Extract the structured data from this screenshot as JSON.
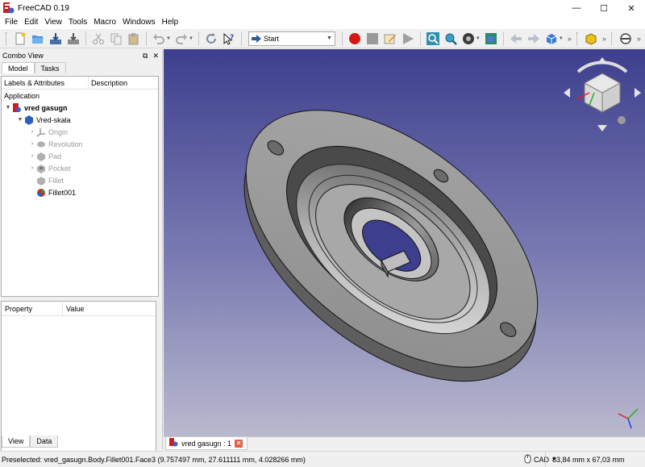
{
  "window": {
    "title": "FreeCAD 0.19",
    "minimize": "—",
    "maximize": "☐",
    "close": "✕"
  },
  "menu": [
    "File",
    "Edit",
    "View",
    "Tools",
    "Macro",
    "Windows",
    "Help"
  ],
  "toolbar": {
    "workbench": "Start"
  },
  "combo_view": {
    "title": "Combo View",
    "tabs": [
      "Model",
      "Tasks"
    ],
    "columns": [
      "Labels & Attributes",
      "Description"
    ],
    "section": "Application",
    "tree": [
      {
        "label": "vred gasugn",
        "level": 0,
        "expanded": true,
        "icon": "document-icon",
        "bold": true
      },
      {
        "label": "Vred-skala",
        "level": 1,
        "expanded": true,
        "icon": "body-icon",
        "bold": false
      },
      {
        "label": "Origin",
        "level": 2,
        "expanded": false,
        "icon": "origin-icon",
        "bold": false,
        "greyed": true
      },
      {
        "label": "Revolution",
        "level": 2,
        "expanded": false,
        "icon": "revolution-icon",
        "bold": false,
        "greyed": true
      },
      {
        "label": "Pad",
        "level": 2,
        "expanded": false,
        "icon": "pad-icon",
        "bold": false,
        "greyed": true
      },
      {
        "label": "Pocket",
        "level": 2,
        "expanded": false,
        "icon": "pocket-icon",
        "bold": false,
        "greyed": true
      },
      {
        "label": "Fillet",
        "level": 2,
        "expanded": null,
        "icon": "fillet-icon",
        "bold": false,
        "greyed": true
      },
      {
        "label": "Fillet001",
        "level": 2,
        "expanded": null,
        "icon": "fillet-icon",
        "bold": false,
        "greyed": false
      }
    ],
    "property_columns": [
      "Property",
      "Value"
    ],
    "bottom_tabs": [
      "View",
      "Data"
    ]
  },
  "document_tab": {
    "label": "vred gasugn : 1"
  },
  "statusbar": {
    "message": "Preselected: vred_gasugn.Body.Fillet001.Face3 (9.757497 mm, 27.611111 mm, 4.028266 mm)",
    "nav_style": "CAD",
    "dimensions": "83,84 mm x 67,03 mm"
  },
  "colors": {
    "viewport_top": "#3d3f8e",
    "viewport_bottom": "#b9b9cf",
    "model_face": "#9a9a9a"
  }
}
